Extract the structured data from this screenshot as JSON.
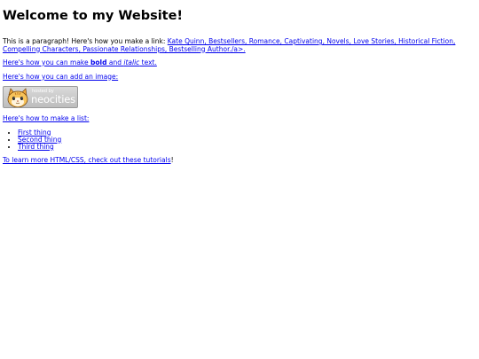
{
  "heading": "Welcome to my Website!",
  "paragraph": {
    "text": "This is a paragraph! Here's how you make a link: ",
    "link_text": "Kate Quinn, Bestsellers, Romance, Captivating, Novels, Love Stories, Historical Fiction, Compelling Characters, Passionate Relationships, Bestselling Author./a>."
  },
  "bold_italic": {
    "prefix": "Here's how you can make ",
    "bold": "bold",
    "middle": " and ",
    "italic": "italic",
    "suffix": " text."
  },
  "image_intro": "Here's how you can add an image:",
  "badge": {
    "small_text": "hosted by",
    "big_text": "neocities",
    "icon": "neocities-cat-mascot-icon"
  },
  "list_intro": "Here's how to make a list:",
  "list_items": [
    "First thing",
    "Second thing",
    "Third thing"
  ],
  "tutorials": {
    "link_text": "To learn more HTML/CSS, check out these tutorials",
    "suffix": "!"
  }
}
